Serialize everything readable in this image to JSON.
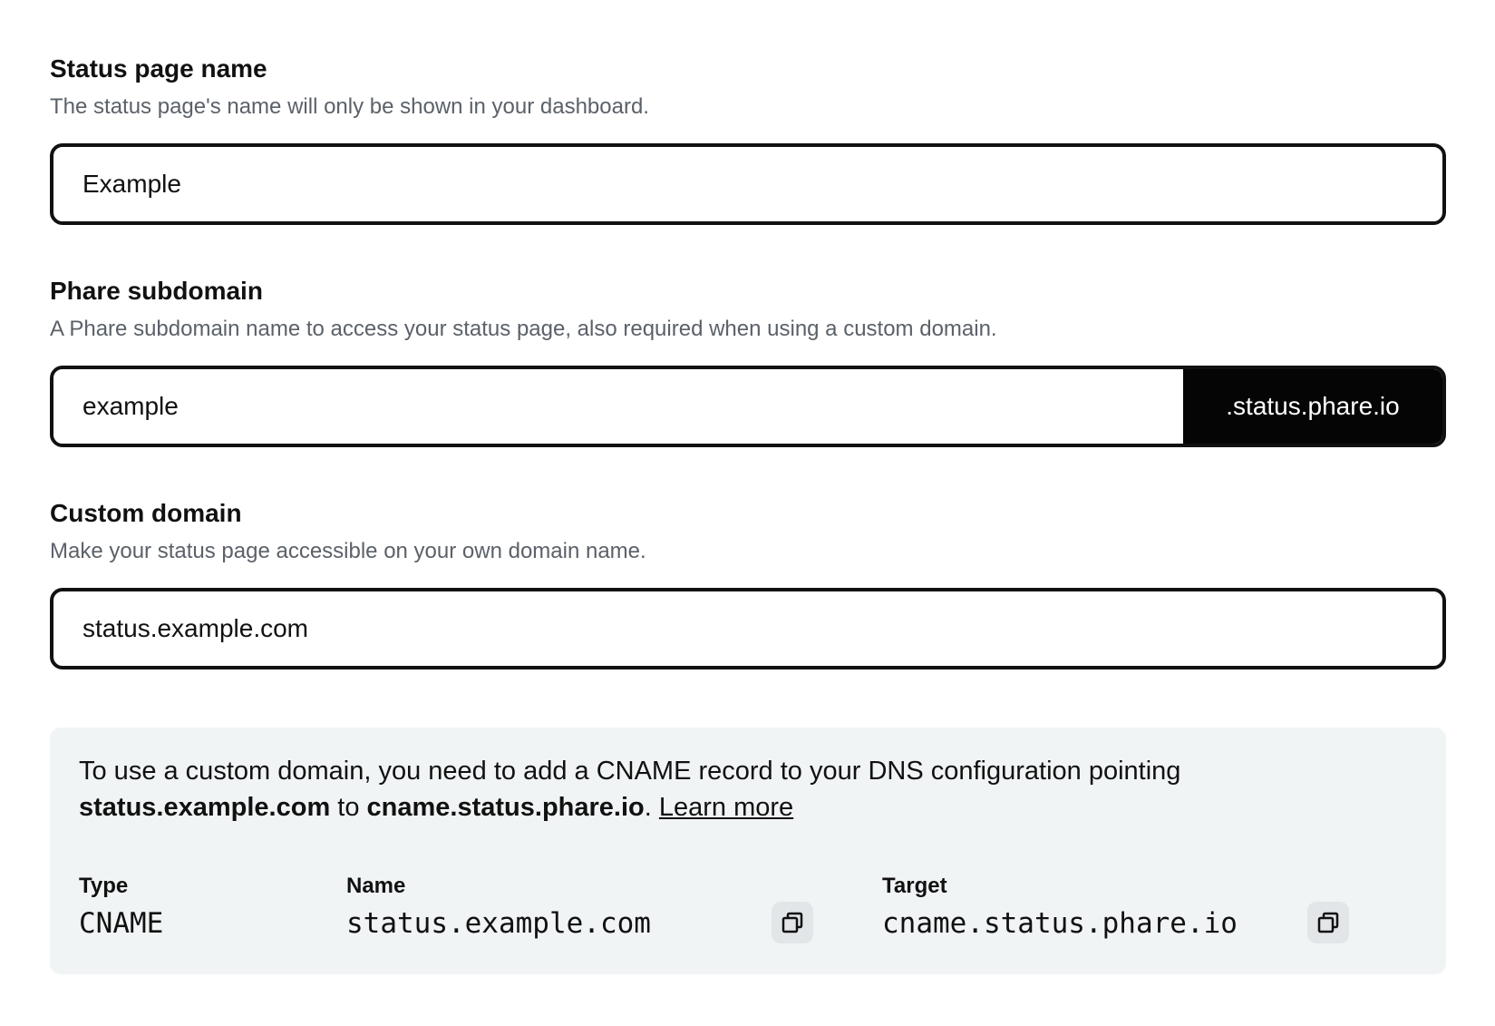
{
  "status_page_name": {
    "label": "Status page name",
    "description": "The status page's name will only be shown in your dashboard.",
    "value": "Example"
  },
  "subdomain": {
    "label": "Phare subdomain",
    "description": "A Phare subdomain name to access your status page, also required when using a custom domain.",
    "value": "example",
    "suffix": ".status.phare.io"
  },
  "custom_domain": {
    "label": "Custom domain",
    "description": "Make your status page accessible on your own domain name.",
    "value": "status.example.com"
  },
  "cname_info": {
    "text_1": "To use a custom domain, you need to add a CNAME record to your DNS configuration pointing",
    "domain": "status.example.com",
    "text_2": " to ",
    "target": "cname.status.phare.io",
    "text_3": ". ",
    "learn_more": "Learn more"
  },
  "dns_record": {
    "type_header": "Type",
    "type_value": "CNAME",
    "name_header": "Name",
    "name_value": "status.example.com",
    "target_header": "Target",
    "target_value": "cname.status.phare.io",
    "copy_icon": "copy-icon"
  }
}
